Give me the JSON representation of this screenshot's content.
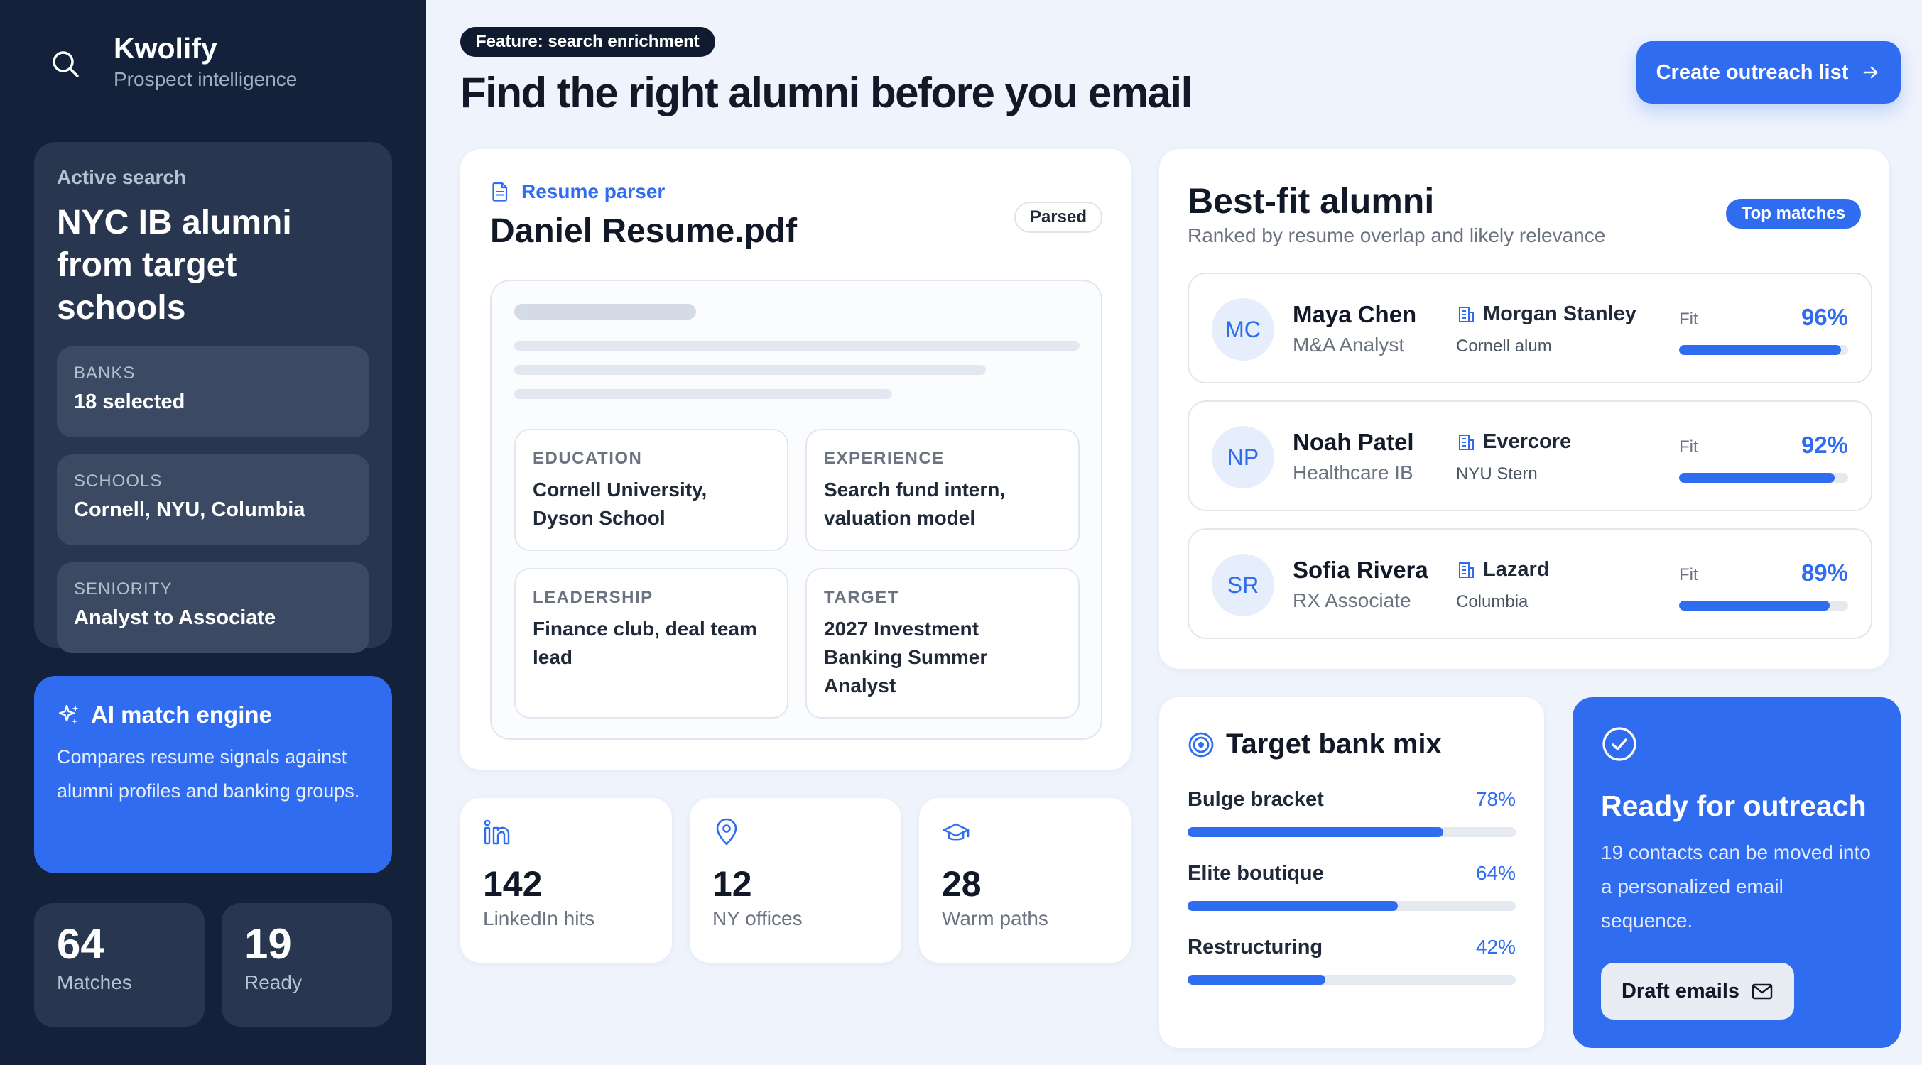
{
  "brand": {
    "name": "Kwolify",
    "tagline": "Prospect intelligence"
  },
  "sidebar": {
    "active_label": "Active search",
    "active_title": "NYC IB alumni from target schools",
    "filters": [
      {
        "label": "BANKS",
        "value": "18 selected"
      },
      {
        "label": "SCHOOLS",
        "value": "Cornell, NYU, Columbia"
      },
      {
        "label": "SENIORITY",
        "value": "Analyst to Associate"
      }
    ],
    "ai": {
      "title": "AI match engine",
      "description": "Compares resume signals against alumni profiles and banking groups."
    },
    "stats": [
      {
        "value": "64",
        "label": "Matches"
      },
      {
        "value": "19",
        "label": "Ready"
      }
    ]
  },
  "header": {
    "feature_pill": "Feature: search enrichment",
    "title": "Find the right alumni before you email",
    "cta_label": "Create outreach list"
  },
  "resume": {
    "parser_label": "Resume parser",
    "file_name": "Daniel Resume.pdf",
    "status": "Parsed",
    "fields": [
      {
        "label": "EDUCATION",
        "value": "Cornell University, Dyson School"
      },
      {
        "label": "EXPERIENCE",
        "value": "Search fund intern, valuation model"
      },
      {
        "label": "LEADERSHIP",
        "value": "Finance club, deal team lead"
      },
      {
        "label": "TARGET",
        "value": "2027 Investment Banking Summer Analyst"
      }
    ]
  },
  "mini_stats": [
    {
      "icon": "linkedin-icon",
      "value": "142",
      "label": "LinkedIn hits"
    },
    {
      "icon": "map-pin-icon",
      "value": "12",
      "label": "NY offices"
    },
    {
      "icon": "graduation-cap-icon",
      "value": "28",
      "label": "Warm paths"
    }
  ],
  "alumni": {
    "title": "Best-fit alumni",
    "subtitle": "Ranked by resume overlap and likely relevance",
    "badge": "Top matches",
    "fit_label": "Fit",
    "people": [
      {
        "initials": "MC",
        "name": "Maya Chen",
        "role": "M&A Analyst",
        "firm": "Morgan Stanley",
        "school": "Cornell alum",
        "fit": "96%",
        "fit_value": 96
      },
      {
        "initials": "NP",
        "name": "Noah Patel",
        "role": "Healthcare IB",
        "firm": "Evercore",
        "school": "NYU Stern",
        "fit": "92%",
        "fit_value": 92
      },
      {
        "initials": "SR",
        "name": "Sofia Rivera",
        "role": "RX Associate",
        "firm": "Lazard",
        "school": "Columbia",
        "fit": "89%",
        "fit_value": 89
      }
    ]
  },
  "bank_mix": {
    "title": "Target bank mix",
    "rows": [
      {
        "name": "Bulge bracket",
        "pct": "78%",
        "value": 78
      },
      {
        "name": "Elite boutique",
        "pct": "64%",
        "value": 64
      },
      {
        "name": "Restructuring",
        "pct": "42%",
        "value": 42
      }
    ]
  },
  "outreach": {
    "title": "Ready for outreach",
    "description": "19 contacts can be moved into a personalized email sequence.",
    "button_label": "Draft emails"
  },
  "colors": {
    "sidebar_bg": "#13213a",
    "sidebar_card": "#283650",
    "accent": "#2f6cf0",
    "page_bg": "#eef3fc"
  }
}
